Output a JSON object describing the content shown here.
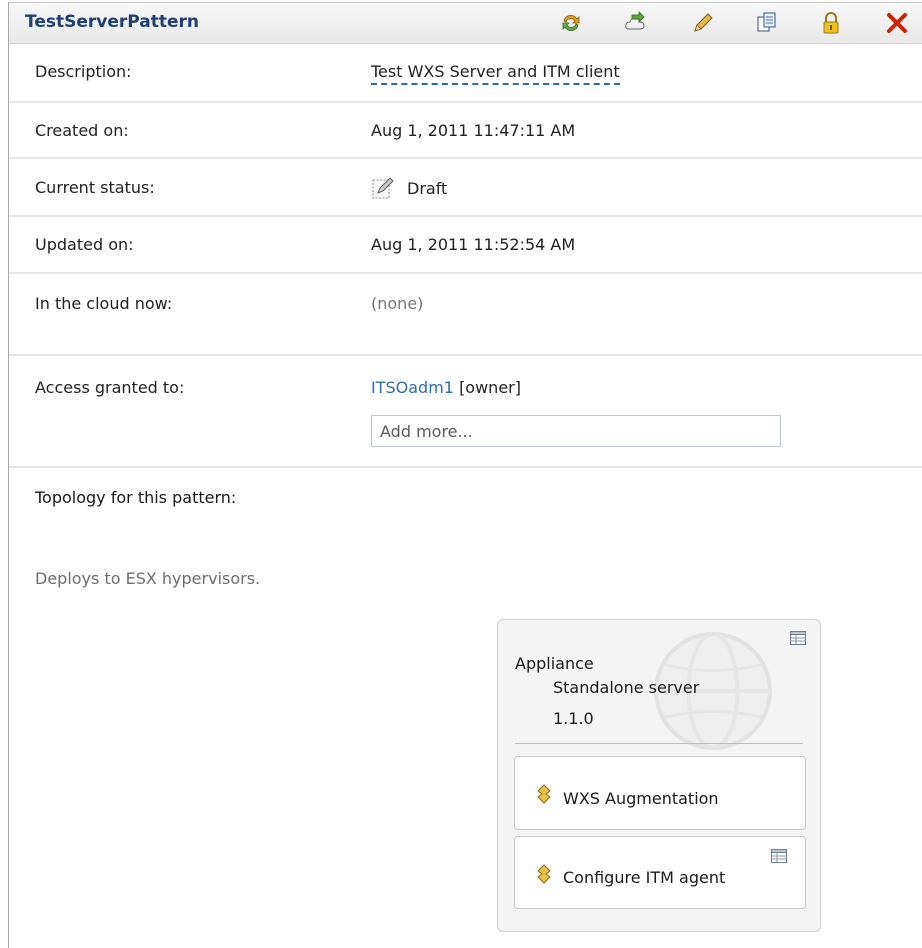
{
  "header": {
    "title": "TestServerPattern"
  },
  "toolbar": {
    "icons": [
      "refresh-icon",
      "deploy-icon",
      "edit-icon",
      "clone-icon",
      "lock-icon",
      "delete-icon"
    ],
    "colors": {
      "delete": "#cc2200",
      "lock": "#d9a400",
      "title": "#1d3f73"
    }
  },
  "details": {
    "description": {
      "label": "Description:",
      "value": "Test WXS Server and ITM client"
    },
    "created": {
      "label": "Created on:",
      "value": "Aug 1, 2011 11:47:11 AM"
    },
    "status": {
      "label": "Current status:",
      "value": "Draft"
    },
    "updated": {
      "label": "Updated on:",
      "value": "Aug 1, 2011 11:52:54 AM"
    },
    "cloud": {
      "label": "In the cloud now:",
      "value": "(none)"
    },
    "access": {
      "label": "Access granted to:",
      "user": "ITSOadm1",
      "role": "[owner]",
      "add_placeholder": "Add more..."
    }
  },
  "topology": {
    "label": "Topology for this pattern:",
    "deploys": "Deploys to ESX hypervisors.",
    "part": {
      "type": "Appliance",
      "name": "Standalone server",
      "version": "1.1.0",
      "scripts": [
        {
          "name": "WXS Augmentation"
        },
        {
          "name": "Configure ITM agent"
        }
      ]
    }
  }
}
